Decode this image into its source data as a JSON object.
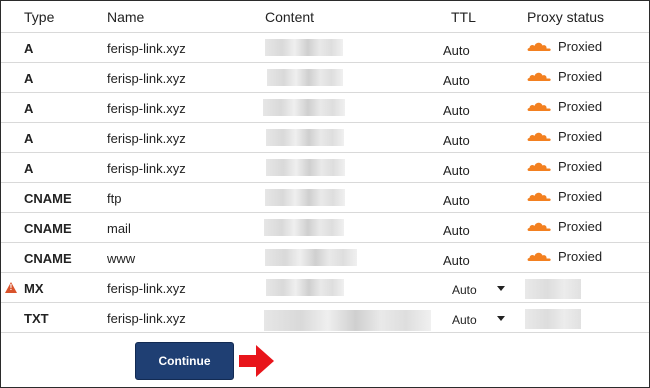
{
  "columns": {
    "type": "Type",
    "name": "Name",
    "content": "Content",
    "ttl": "TTL",
    "proxy": "Proxy status"
  },
  "rows": [
    {
      "type": "A",
      "name": "ferisp-link.xyz",
      "ttl": "Auto",
      "proxy": "Proxied"
    },
    {
      "type": "A",
      "name": "ferisp-link.xyz",
      "ttl": "Auto",
      "proxy": "Proxied"
    },
    {
      "type": "A",
      "name": "ferisp-link.xyz",
      "ttl": "Auto",
      "proxy": "Proxied"
    },
    {
      "type": "A",
      "name": "ferisp-link.xyz",
      "ttl": "Auto",
      "proxy": "Proxied"
    },
    {
      "type": "A",
      "name": "ferisp-link.xyz",
      "ttl": "Auto",
      "proxy": "Proxied"
    },
    {
      "type": "CNAME",
      "name": "ftp",
      "ttl": "Auto",
      "proxy": "Proxied"
    },
    {
      "type": "CNAME",
      "name": "mail",
      "ttl": "Auto",
      "proxy": "Proxied"
    },
    {
      "type": "CNAME",
      "name": "www",
      "ttl": "Auto",
      "proxy": "Proxied"
    },
    {
      "type": "MX",
      "name": "ferisp-link.xyz",
      "ttl": "Auto",
      "warning_icon": "warning-triangle-icon"
    },
    {
      "type": "TXT",
      "name": "ferisp-link.xyz",
      "ttl": "Auto"
    }
  ],
  "icons": {
    "cloud": "cloud-icon",
    "arrow": "arrow-right-icon",
    "warning": "warning-triangle-icon"
  },
  "continue_label": "Continue",
  "colors": {
    "button_bg": "#1f3f73",
    "cloud_orange": "#f38020",
    "arrow_red": "#e8151b",
    "warning": "#d9532b"
  }
}
